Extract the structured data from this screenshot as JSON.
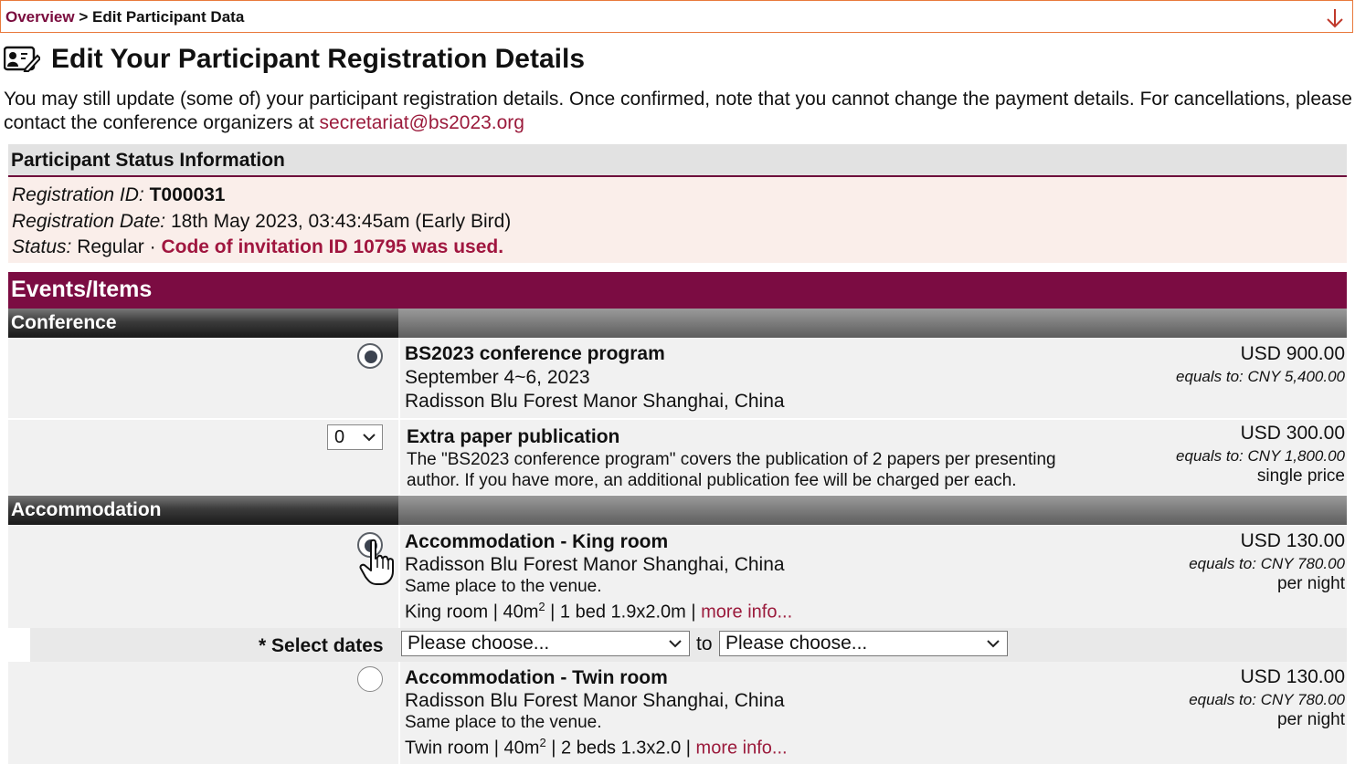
{
  "breadcrumb": {
    "overview": "Overview",
    "separator": ">",
    "current": "Edit Participant Data",
    "arrow_icon": "arrow-down-icon"
  },
  "page": {
    "icon": "id-card-edit-icon",
    "title": "Edit Your Participant Registration Details",
    "intro": "You may still update (some of) your participant registration details. Once confirmed, note that you cannot change the payment details. For cancellations, please contact the conference organizers at",
    "email": "secretariat@bs2023.org"
  },
  "status": {
    "heading": "Participant Status Information",
    "reg_id_label": "Registration ID:",
    "reg_id": "T000031",
    "reg_date_label": "Registration Date:",
    "reg_date": "18th May 2023, 03:43:45am (Early Bird)",
    "status_label": "Status:",
    "status_value": "Regular",
    "sep": "·",
    "invitation": "Code of invitation ID 10795 was used."
  },
  "events": {
    "heading": "Events/Items",
    "conference_label": "Conference",
    "accommodation_label": "Accommodation",
    "items": [
      {
        "title": "BS2023 conference program",
        "line1": "September 4~6, 2023",
        "line2": "Radisson Blu Forest Manor Shanghai, China",
        "usd": "USD 900.00",
        "eq_label": "equals to:",
        "eq_value": "CNY 5,400.00",
        "selected": true
      },
      {
        "title": "Extra paper publication",
        "quantity": "0",
        "line1": "The \"BS2023 conference program\" covers the publication of 2 papers per presenting",
        "line2": "author. If you have more, an additional publication fee will be charged per each.",
        "usd": "USD 300.00",
        "eq_label": "equals to:",
        "eq_value": "CNY 1,800.00",
        "note": "single price"
      },
      {
        "title": "Accommodation - King room",
        "line1": "Radisson Blu Forest Manor Shanghai, China",
        "line2": "Same place to the venue.",
        "spec_pre": "King room | 40m",
        "spec_sup": "2",
        "spec_post": " | 1 bed 1.9x2.0m | ",
        "more": "more info...",
        "usd": "USD 130.00",
        "eq_label": "equals to:",
        "eq_value": "CNY 780.00",
        "note": "per night",
        "selected": true
      },
      {
        "title": "Accommodation - Twin room",
        "line1": "Radisson Blu Forest Manor Shanghai, China",
        "line2": "Same place to the venue.",
        "spec_pre": "Twin room | 40m",
        "spec_sup": "2",
        "spec_post": " | 2 beds 1.3x2.0 | ",
        "more": "more info...",
        "usd": "USD 130.00",
        "eq_label": "equals to:",
        "eq_value": "CNY 780.00",
        "note": "per night",
        "selected": false
      }
    ]
  },
  "dates": {
    "label": "* Select dates",
    "from_placeholder": "Please choose...",
    "to_label": "to",
    "to_placeholder": "Please choose..."
  },
  "colors": {
    "brand": "#7b0c42",
    "link": "#9b1b3c",
    "status_bg": "#faeeea",
    "breadcrumb_border": "#e8793c"
  }
}
